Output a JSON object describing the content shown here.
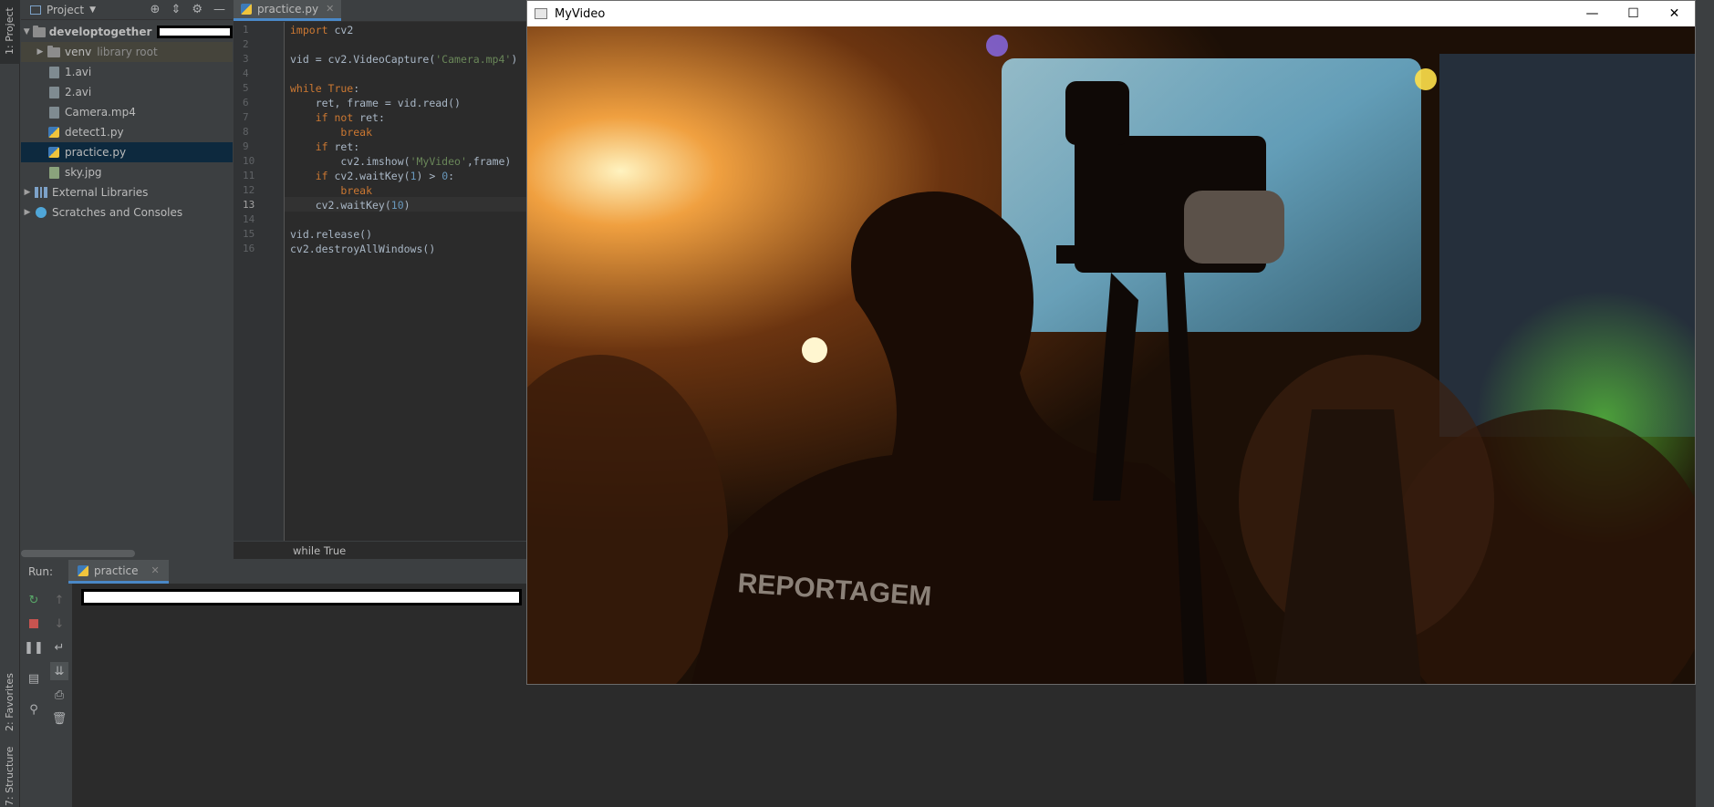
{
  "left_strip": {
    "project_tab": "1: Project",
    "favorites_tab": "2: Favorites",
    "structure_tab": "7: Structure"
  },
  "project_panel": {
    "title": "Project",
    "root": {
      "name": "developtogether"
    },
    "items": [
      {
        "label": "venv",
        "suffix": "library root",
        "type": "folder"
      },
      {
        "label": "1.avi",
        "type": "file"
      },
      {
        "label": "2.avi",
        "type": "file"
      },
      {
        "label": "Camera.mp4",
        "type": "file"
      },
      {
        "label": "detect1.py",
        "type": "py"
      },
      {
        "label": "practice.py",
        "type": "py"
      },
      {
        "label": "sky.jpg",
        "type": "image"
      }
    ],
    "external_libraries": "External Libraries",
    "scratches": "Scratches and Consoles"
  },
  "editor": {
    "tab_label": "practice.py",
    "line_numbers": [
      "1",
      "2",
      "3",
      "4",
      "5",
      "6",
      "7",
      "8",
      "9",
      "10",
      "11",
      "12",
      "13",
      "14",
      "15",
      "16"
    ],
    "breadcrumb": "while True"
  },
  "run_panel": {
    "label": "Run:",
    "tab_label": "practice"
  },
  "video_window": {
    "title": "MyVideo",
    "frame_text": "REPORTAGEM"
  },
  "colors": {
    "editor_bg": "#2b2b2b",
    "panel_bg": "#3c3f41",
    "keyword": "#cc7832",
    "string": "#6a8759",
    "number": "#6897bb",
    "selection": "#0d293e"
  }
}
